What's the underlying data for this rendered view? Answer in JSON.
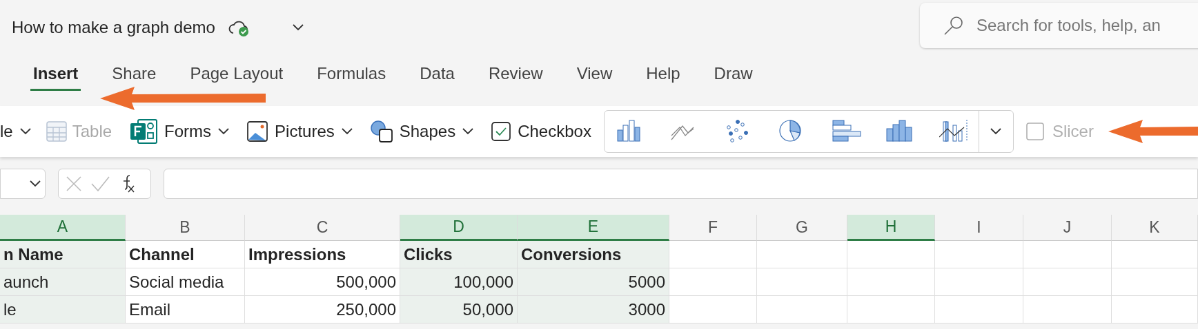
{
  "window": {
    "title": "How to make a graph demo"
  },
  "search": {
    "placeholder": "Search for tools, help, an"
  },
  "tabs": [
    {
      "label": "Insert",
      "selected": true
    },
    {
      "label": "Share",
      "selected": false
    },
    {
      "label": "Page Layout",
      "selected": false
    },
    {
      "label": "Formulas",
      "selected": false
    },
    {
      "label": "Data",
      "selected": false
    },
    {
      "label": "Review",
      "selected": false
    },
    {
      "label": "View",
      "selected": false
    },
    {
      "label": "Help",
      "selected": false
    },
    {
      "label": "Draw",
      "selected": false
    }
  ],
  "ribbon": [
    {
      "kind": "cut",
      "label": "le",
      "disabled": false
    },
    {
      "kind": "table",
      "label": "Table",
      "disabled": true
    },
    {
      "kind": "forms",
      "label": "Forms",
      "disabled": false
    },
    {
      "kind": "pictures",
      "label": "Pictures",
      "disabled": false
    },
    {
      "kind": "shapes",
      "label": "Shapes",
      "disabled": false
    },
    {
      "kind": "checkbox",
      "label": "Checkbox",
      "disabled": false
    }
  ],
  "slicer": {
    "label": "Slicer",
    "disabled": true
  },
  "columns": [
    {
      "letter": "A",
      "selected": true
    },
    {
      "letter": "B",
      "selected": false
    },
    {
      "letter": "C",
      "selected": false
    },
    {
      "letter": "D",
      "selected": true
    },
    {
      "letter": "E",
      "selected": true
    },
    {
      "letter": "F",
      "selected": false
    },
    {
      "letter": "G",
      "selected": false
    },
    {
      "letter": "H",
      "selected": true
    },
    {
      "letter": "I",
      "selected": false
    },
    {
      "letter": "J",
      "selected": false
    },
    {
      "letter": "K",
      "selected": false
    }
  ],
  "rows": [
    [
      "n Name",
      "Channel",
      "Impressions",
      "Clicks",
      "Conversions"
    ],
    [
      "aunch",
      "Social media",
      "500,000",
      "100,000",
      "5000"
    ],
    [
      "le",
      "Email",
      "250,000",
      "50,000",
      "3000"
    ]
  ]
}
